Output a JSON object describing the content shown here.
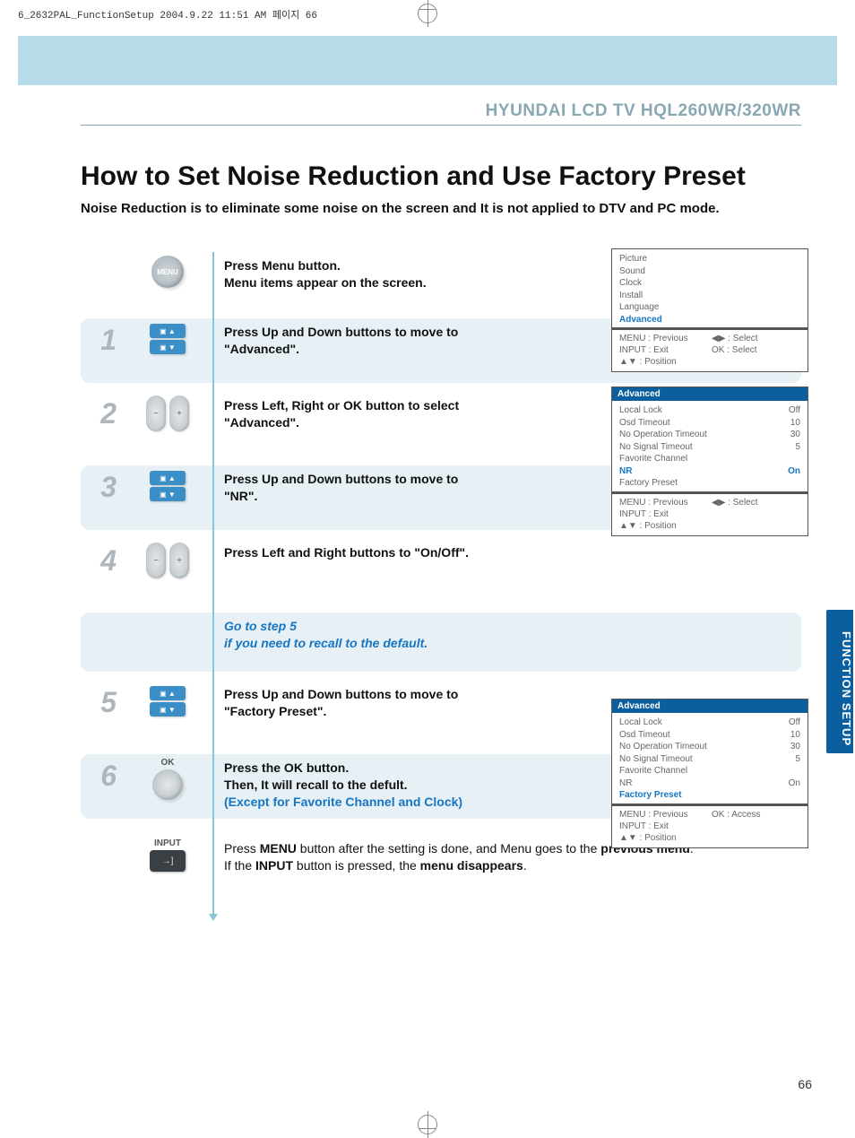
{
  "print_header": "6_2632PAL_FunctionSetup  2004.9.22 11:51 AM  페이지 66",
  "header_brand": "HYUNDAI LCD TV HQL260WR/320WR",
  "title": "How to Set Noise Reduction and Use Factory Preset",
  "subtitle": "Noise Reduction is to eliminate some noise on the screen and It is not applied to DTV and PC mode.",
  "tab_label": "FUNCTION SETUP",
  "page_number": "66",
  "steps": {
    "menu": {
      "text1": "Press Menu button.",
      "text2": "Menu items appear on the screen.",
      "btn": "MENU"
    },
    "s1": {
      "num": "1",
      "text1": "Press Up and Down buttons to move to",
      "text2": "\"Advanced\"."
    },
    "s2": {
      "num": "2",
      "text1": "Press Left, Right or OK button to select",
      "text2": "\"Advanced\"."
    },
    "s3": {
      "num": "3",
      "text1": "Press Up and Down buttons to move to",
      "text2": "\"NR\"."
    },
    "s4": {
      "num": "4",
      "text1": "Press Left and Right buttons to \"On/Off\"."
    },
    "note": {
      "line1": "Go to step 5",
      "line2": "if you need to recall to the default."
    },
    "s5": {
      "num": "5",
      "text1": "Press Up and Down buttons to move to",
      "text2": "\"Factory Preset\"."
    },
    "s6": {
      "num": "6",
      "ok_label": "OK",
      "text1": "Press the OK button.",
      "text2": "Then, It will recall to the defult.",
      "text3": "(Except for Favorite Channel and Clock)"
    },
    "final": {
      "input_label": "INPUT",
      "line1a": "Press ",
      "line1b": "MENU",
      "line1c": " button after the setting is done, and Menu goes to the ",
      "line1d": "previous menu",
      "line1e": ".",
      "line2a": "If the ",
      "line2b": "INPUT",
      "line2c": " button is pressed, the ",
      "line2d": "menu disappears",
      "line2e": "."
    }
  },
  "osd1": {
    "items": [
      "Picture",
      "Sound",
      "Clock",
      "Install",
      "Language"
    ],
    "highlight": "Advanced",
    "foot": {
      "a": "MENU : Previous",
      "b": "◀▶ : Select",
      "c": "INPUT : Exit",
      "d": "OK : Select",
      "e": "▲▼ : Position"
    }
  },
  "osd2": {
    "title": "Advanced",
    "rows": [
      {
        "l": "Local Lock",
        "r": "Off"
      },
      {
        "l": "Osd Timeout",
        "r": "10"
      },
      {
        "l": "No Operation Timeout",
        "r": "30"
      },
      {
        "l": "No Signal Timeout",
        "r": "5"
      },
      {
        "l": "Favorite Channel",
        "r": ""
      }
    ],
    "hl": {
      "l": "NR",
      "r": "On"
    },
    "last": {
      "l": "Factory Preset",
      "r": ""
    },
    "foot": {
      "a": "MENU : Previous",
      "b": "◀▶ : Select",
      "c": "INPUT : Exit",
      "d": "",
      "e": "▲▼ : Position"
    }
  },
  "osd3": {
    "title": "Advanced",
    "rows": [
      {
        "l": "Local Lock",
        "r": "Off"
      },
      {
        "l": "Osd Timeout",
        "r": "10"
      },
      {
        "l": "No Operation Timeout",
        "r": "30"
      },
      {
        "l": "No Signal Timeout",
        "r": "5"
      },
      {
        "l": "Favorite Channel",
        "r": ""
      },
      {
        "l": "NR",
        "r": "On"
      }
    ],
    "hl": {
      "l": "Factory Preset",
      "r": ""
    },
    "foot": {
      "a": "MENU : Previous",
      "b": "OK : Access",
      "c": "INPUT : Exit",
      "d": "",
      "e": "▲▼ : Position"
    }
  }
}
